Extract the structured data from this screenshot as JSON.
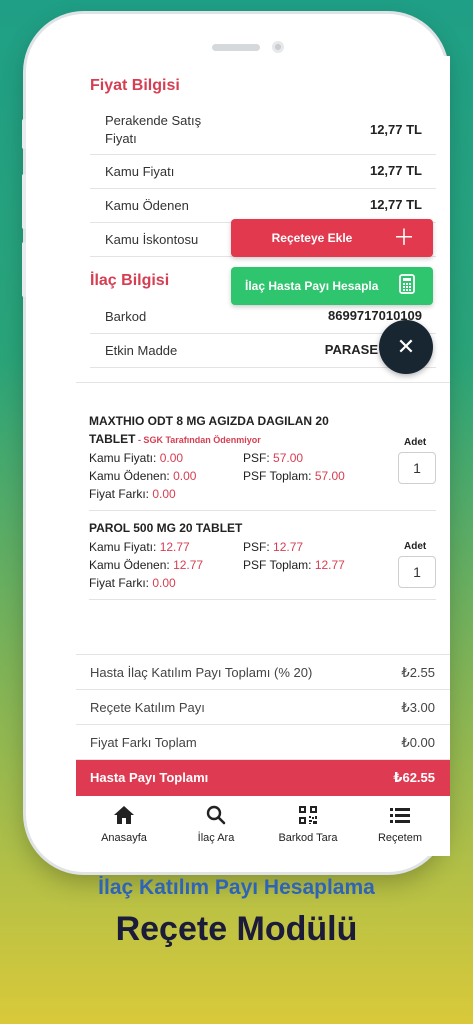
{
  "fiyat_bilgisi": {
    "title": "Fiyat Bilgisi",
    "rows": [
      {
        "label_line1": "Perakende Satış",
        "label_line2": "Fiyatı",
        "value": "12,77 TL"
      },
      {
        "label": "Kamu Fiyatı",
        "value": "12,77 TL"
      },
      {
        "label": "Kamu Ödenen",
        "value": "12,77 TL"
      },
      {
        "label": "Kamu İskontosu",
        "value": ""
      }
    ]
  },
  "ilac_bilgisi": {
    "title": "İlaç Bilgisi",
    "rows": [
      {
        "label": "Barkod",
        "value": "8699717010109"
      },
      {
        "label": "Etkin Madde",
        "value": "PARASE"
      }
    ]
  },
  "fab": {
    "recete_ekle": "Reçeteye Ekle",
    "hasta_payi": "İlaç Hasta Payı Hesapla",
    "recete_color": "#e2394f",
    "hasta_color": "#2fc46e"
  },
  "drugs": [
    {
      "name_line1": "MAXTHIO ODT 8 MG AGIZDA DAGILAN 20",
      "name_line2": "TABLET",
      "note": " - SGK Tarafından Ödenmiyor",
      "kamu_fiyati_label": "Kamu Fiyatı:",
      "kamu_fiyati": "0.00",
      "kamu_odenen_label": "Kamu Ödenen:",
      "kamu_odenen": "0.00",
      "fiyat_farki_label": "Fiyat Farkı:",
      "fiyat_farki": "0.00",
      "psf_label": "PSF:",
      "psf": "57.00",
      "psf_toplam_label": "PSF Toplam:",
      "psf_toplam": "57.00",
      "adet_label": "Adet",
      "adet": "1"
    },
    {
      "name_line1": "PAROL 500 MG 20 TABLET",
      "kamu_fiyati_label": "Kamu Fiyatı:",
      "kamu_fiyati": "12.77",
      "kamu_odenen_label": "Kamu Ödenen:",
      "kamu_odenen": "12.77",
      "fiyat_farki_label": "Fiyat Farkı:",
      "fiyat_farki": "0.00",
      "psf_label": "PSF:",
      "psf": "12.77",
      "psf_toplam_label": "PSF Toplam:",
      "psf_toplam": "12.77",
      "adet_label": "Adet",
      "adet": "1"
    }
  ],
  "summary": [
    {
      "label": "Hasta İlaç Katılım Payı Toplamı (% 20)",
      "value": "₺2.55"
    },
    {
      "label": "Reçete Katılım Payı",
      "value": "₺3.00"
    },
    {
      "label": "Fiyat Farkı Toplam",
      "value": "₺0.00"
    }
  ],
  "total": {
    "label": "Hasta Payı Toplamı",
    "value": "₺62.55"
  },
  "nav": [
    {
      "label": "Anasayfa",
      "icon": "home-icon"
    },
    {
      "label": "İlaç Ara",
      "icon": "search-icon"
    },
    {
      "label": "Barkod Tara",
      "icon": "qr-code-icon"
    },
    {
      "label": "Reçetem",
      "icon": "list-icon"
    }
  ],
  "caption": {
    "line1": "İlaç Katılım Payı Hesaplama",
    "line2": "Reçete Modülü"
  }
}
